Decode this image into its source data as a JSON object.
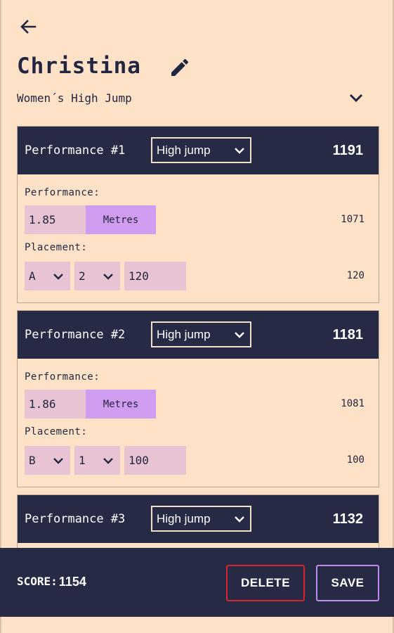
{
  "header": {
    "title": "Christina",
    "event": "Women´s High Jump"
  },
  "performances": [
    {
      "label": "Performance #1",
      "discipline": "High jump",
      "score": "1191",
      "performance_label": "Performance:",
      "value": "1.85",
      "unit": "Metres",
      "performance_points": "1071",
      "placement_label": "Placement:",
      "round": "A",
      "place": "2",
      "placement_value": "120",
      "placement_points": "120"
    },
    {
      "label": "Performance #2",
      "discipline": "High jump",
      "score": "1181",
      "performance_label": "Performance:",
      "value": "1.86",
      "unit": "Metres",
      "performance_points": "1081",
      "placement_label": "Placement:",
      "round": "B",
      "place": "1",
      "placement_value": "100",
      "placement_points": "100"
    },
    {
      "label": "Performance #3",
      "discipline": "High jump",
      "score": "1132"
    }
  ],
  "footer": {
    "score_label": "SCORE:",
    "score_value": "1154",
    "delete_label": "DELETE",
    "save_label": "SAVE"
  },
  "colors": {
    "background": "#fde2c8",
    "header": "#272a45",
    "input": "#e8c3d4",
    "unit": "#cf9cf0",
    "delete_border": "#d9232f",
    "save_border": "#c08cf0"
  },
  "icons": {
    "back": "arrow-left-icon",
    "edit": "pencil-icon",
    "expand": "chevron-down-icon"
  }
}
